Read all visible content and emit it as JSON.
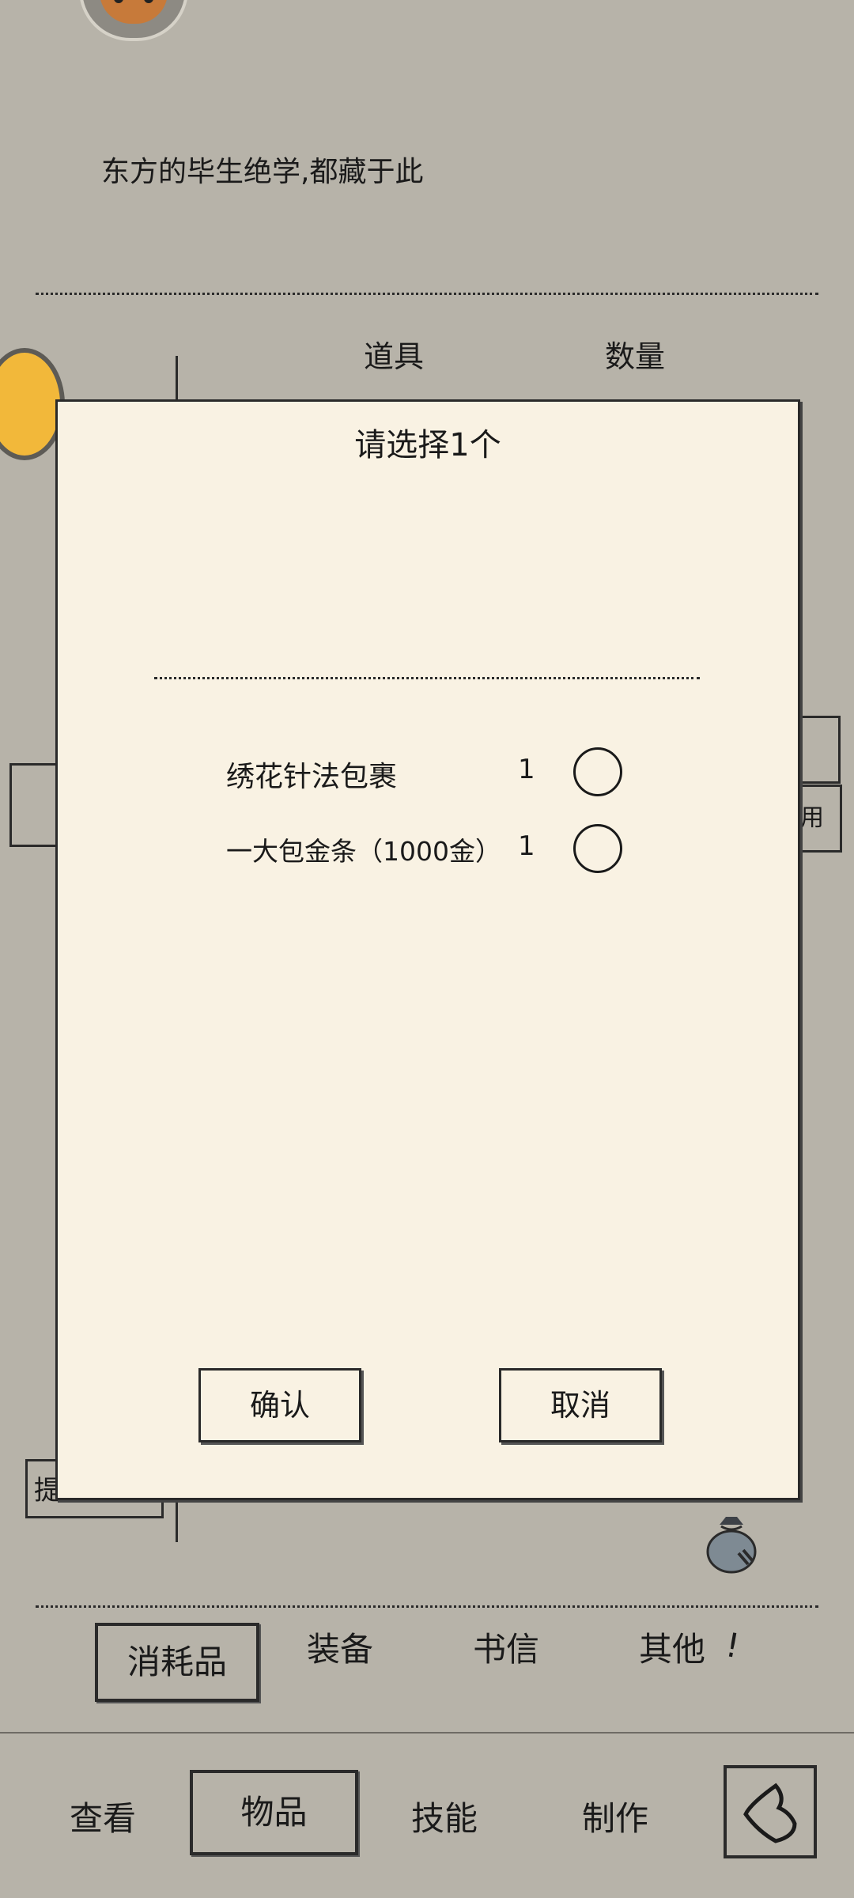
{
  "background": {
    "subtitle": "东方的毕生绝学,都藏于此",
    "columns": {
      "item": "道具",
      "quantity": "数量"
    },
    "use_button_partial": "用",
    "tip_button_partial": "提"
  },
  "categories": {
    "consumables": "消耗品",
    "equipment": "装备",
    "letters": "书信",
    "other": "其他"
  },
  "exclaim": "!",
  "bottom_nav": {
    "view": "查看",
    "items": "物品",
    "skills": "技能",
    "craft": "制作"
  },
  "dialog": {
    "title": "请选择1个",
    "options": [
      {
        "name": "绣花针法包裹",
        "quantity": "1",
        "selected": false
      },
      {
        "name": "一大包金条（1000金）",
        "quantity": "1",
        "selected": false
      }
    ],
    "confirm_label": "确认",
    "cancel_label": "取消"
  },
  "colors": {
    "page_background": "#b7b3a9",
    "dialog_background": "#f9f2e3",
    "ink": "#1a1a1a"
  }
}
